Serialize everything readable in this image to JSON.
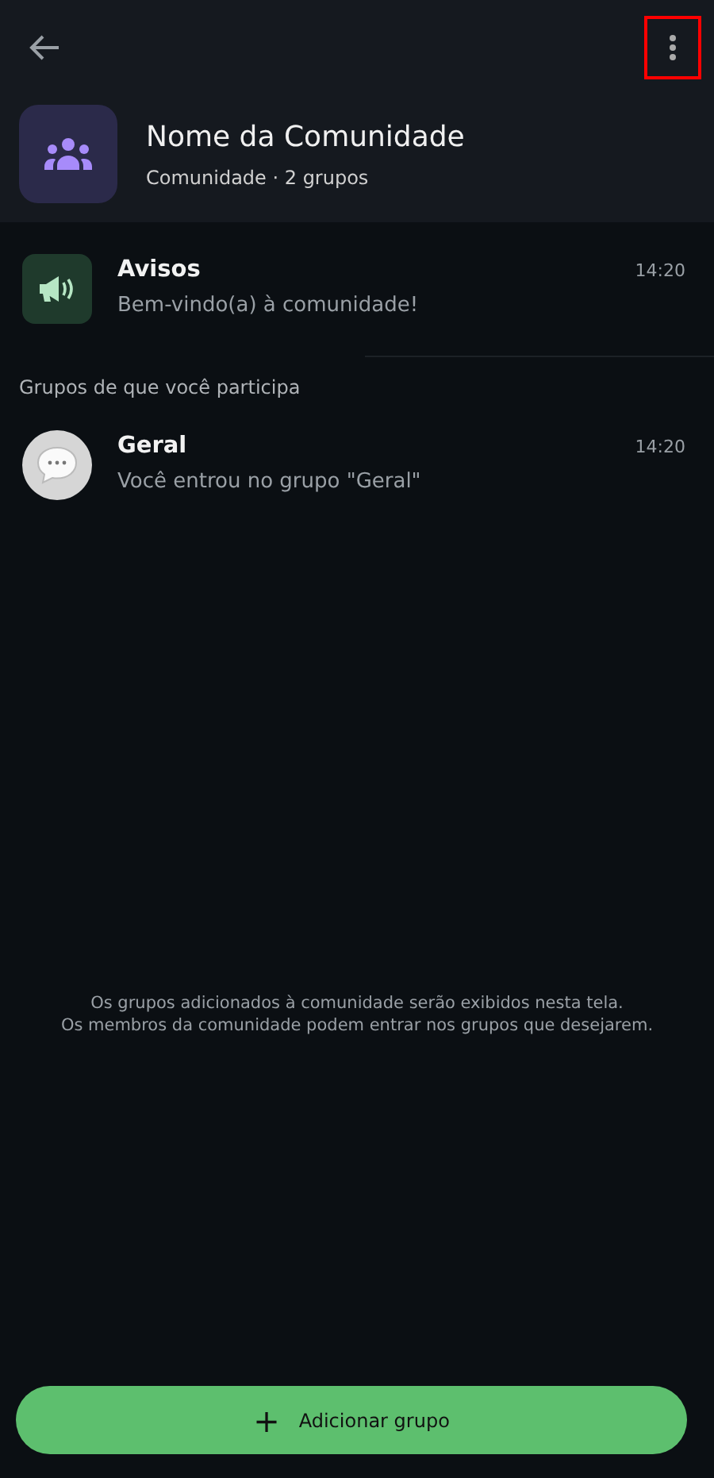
{
  "header": {
    "menu_highlighted": true,
    "title": "Nome da Comunidade",
    "subtitle": "Comunidade · 2 grupos"
  },
  "announcements": {
    "kind": "announcement",
    "name": "Avisos",
    "message": "Bem-vindo(a) à comunidade!",
    "time": "14:20"
  },
  "section_label": "Grupos de que você participa",
  "groups": [
    {
      "kind": "group",
      "name": "Geral",
      "message": "Você entrou no grupo \"Geral\"",
      "time": "14:20"
    }
  ],
  "info_lines": [
    "Os grupos adicionados à comunidade serão exibidos nesta tela.",
    "Os membros da comunidade podem entrar nos grupos que desejarem."
  ],
  "add_button": {
    "icon": "+",
    "label": "Adicionar grupo"
  }
}
